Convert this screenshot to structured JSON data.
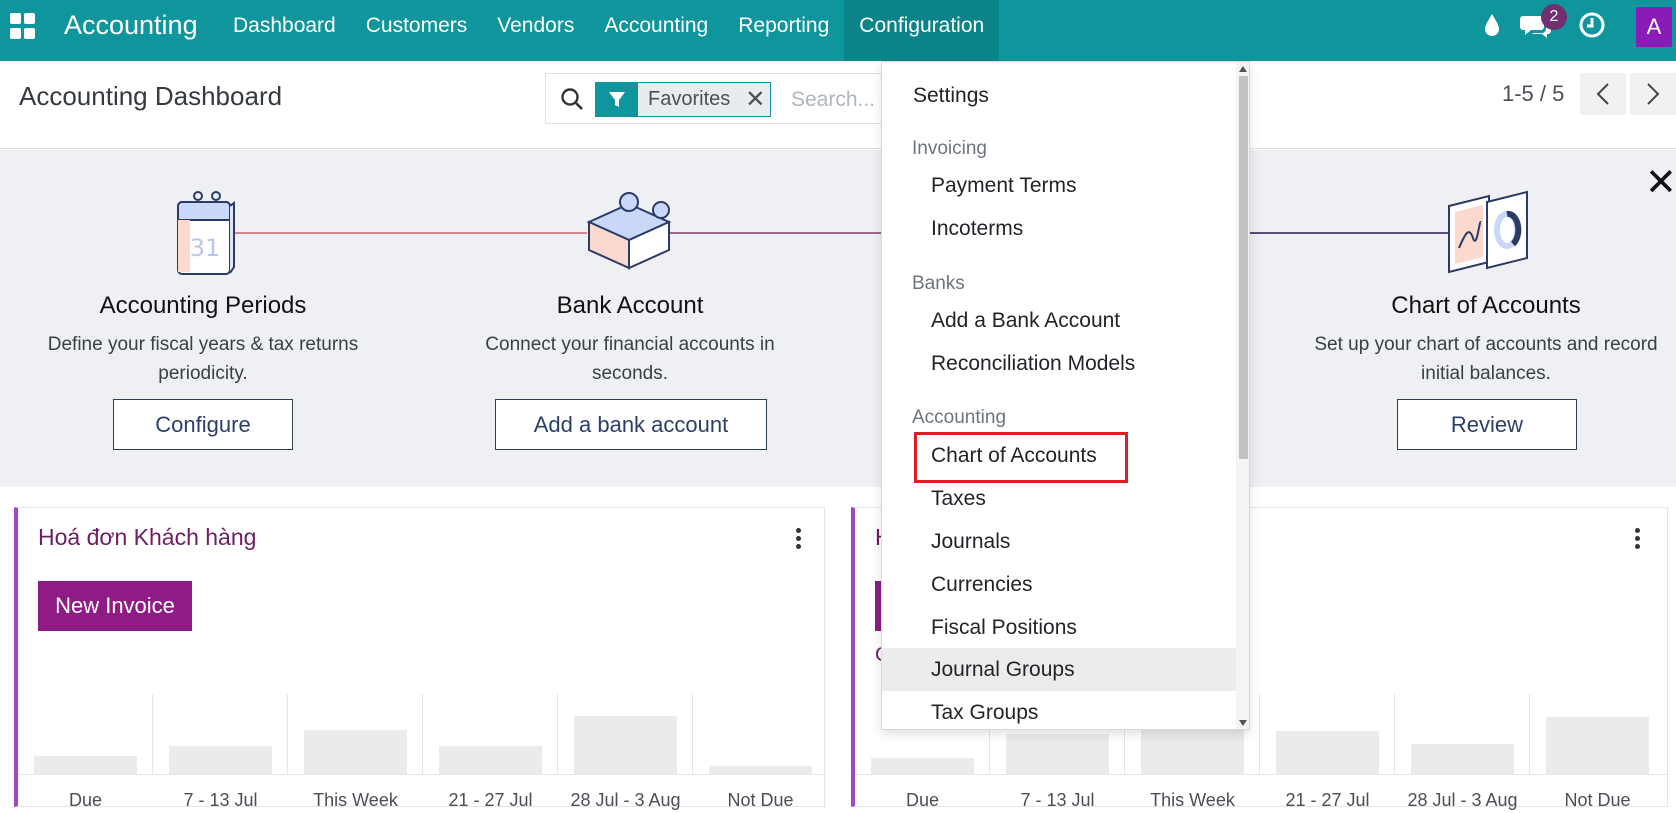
{
  "navbar": {
    "app_name": "Accounting",
    "menu": [
      "Dashboard",
      "Customers",
      "Vendors",
      "Accounting",
      "Reporting",
      "Configuration"
    ],
    "active_menu": "Configuration",
    "chat_badge": "2",
    "avatar_letter": "A",
    "color": "#0f969c"
  },
  "control_panel": {
    "title": "Accounting Dashboard",
    "facet_label": "Favorites",
    "facet_remove": "✕",
    "search_placeholder": "Search...",
    "pager": "1-5 / 5"
  },
  "onboarding": {
    "close": "✕",
    "steps": [
      {
        "title": "Accounting Periods",
        "desc_line1": "Define your fiscal years & tax returns",
        "desc_line2": "periodicity.",
        "button": "Configure"
      },
      {
        "title": "Bank Account",
        "desc_line1": "Connect your financial accounts in",
        "desc_line2": "seconds.",
        "button": "Add a bank account"
      },
      {
        "title": "Chart of Accounts",
        "desc_line1": "Set up your chart of accounts and record",
        "desc_line2": "initial balances.",
        "button": "Review"
      }
    ],
    "calendar_day": "31"
  },
  "cards": [
    {
      "title": "Hoá đơn Khách hàng",
      "button": "New Invoice",
      "chart_data": {
        "type": "bar",
        "categories": [
          "Due",
          "7 - 13 Jul",
          "This Week",
          "21 - 27 Jul",
          "28 Jul - 3 Aug",
          "Not Due"
        ],
        "values": [
          18,
          28,
          44,
          28,
          58,
          8
        ],
        "ylim": [
          0,
          80
        ]
      }
    },
    {
      "title": "H",
      "subtitle": "C",
      "chart_data": {
        "type": "bar",
        "categories": [
          "Due",
          "7 - 13 Jul",
          "This Week",
          "21 - 27 Jul",
          "28 Jul - 3 Aug",
          "Not Due"
        ],
        "values": [
          16,
          40,
          44,
          43,
          30,
          57
        ],
        "ylim": [
          0,
          80
        ]
      }
    }
  ],
  "dropdown": {
    "top_item": "Settings",
    "sections": [
      {
        "header": "Invoicing",
        "items": [
          "Payment Terms",
          "Incoterms"
        ]
      },
      {
        "header": "Banks",
        "items": [
          "Add a Bank Account",
          "Reconciliation Models"
        ]
      },
      {
        "header": "Accounting",
        "items": [
          "Chart of Accounts",
          "Taxes",
          "Journals",
          "Currencies",
          "Fiscal Positions",
          "Journal Groups",
          "Tax Groups"
        ]
      }
    ],
    "highlighted_item": "Chart of Accounts",
    "hovered_item": "Journal Groups"
  }
}
